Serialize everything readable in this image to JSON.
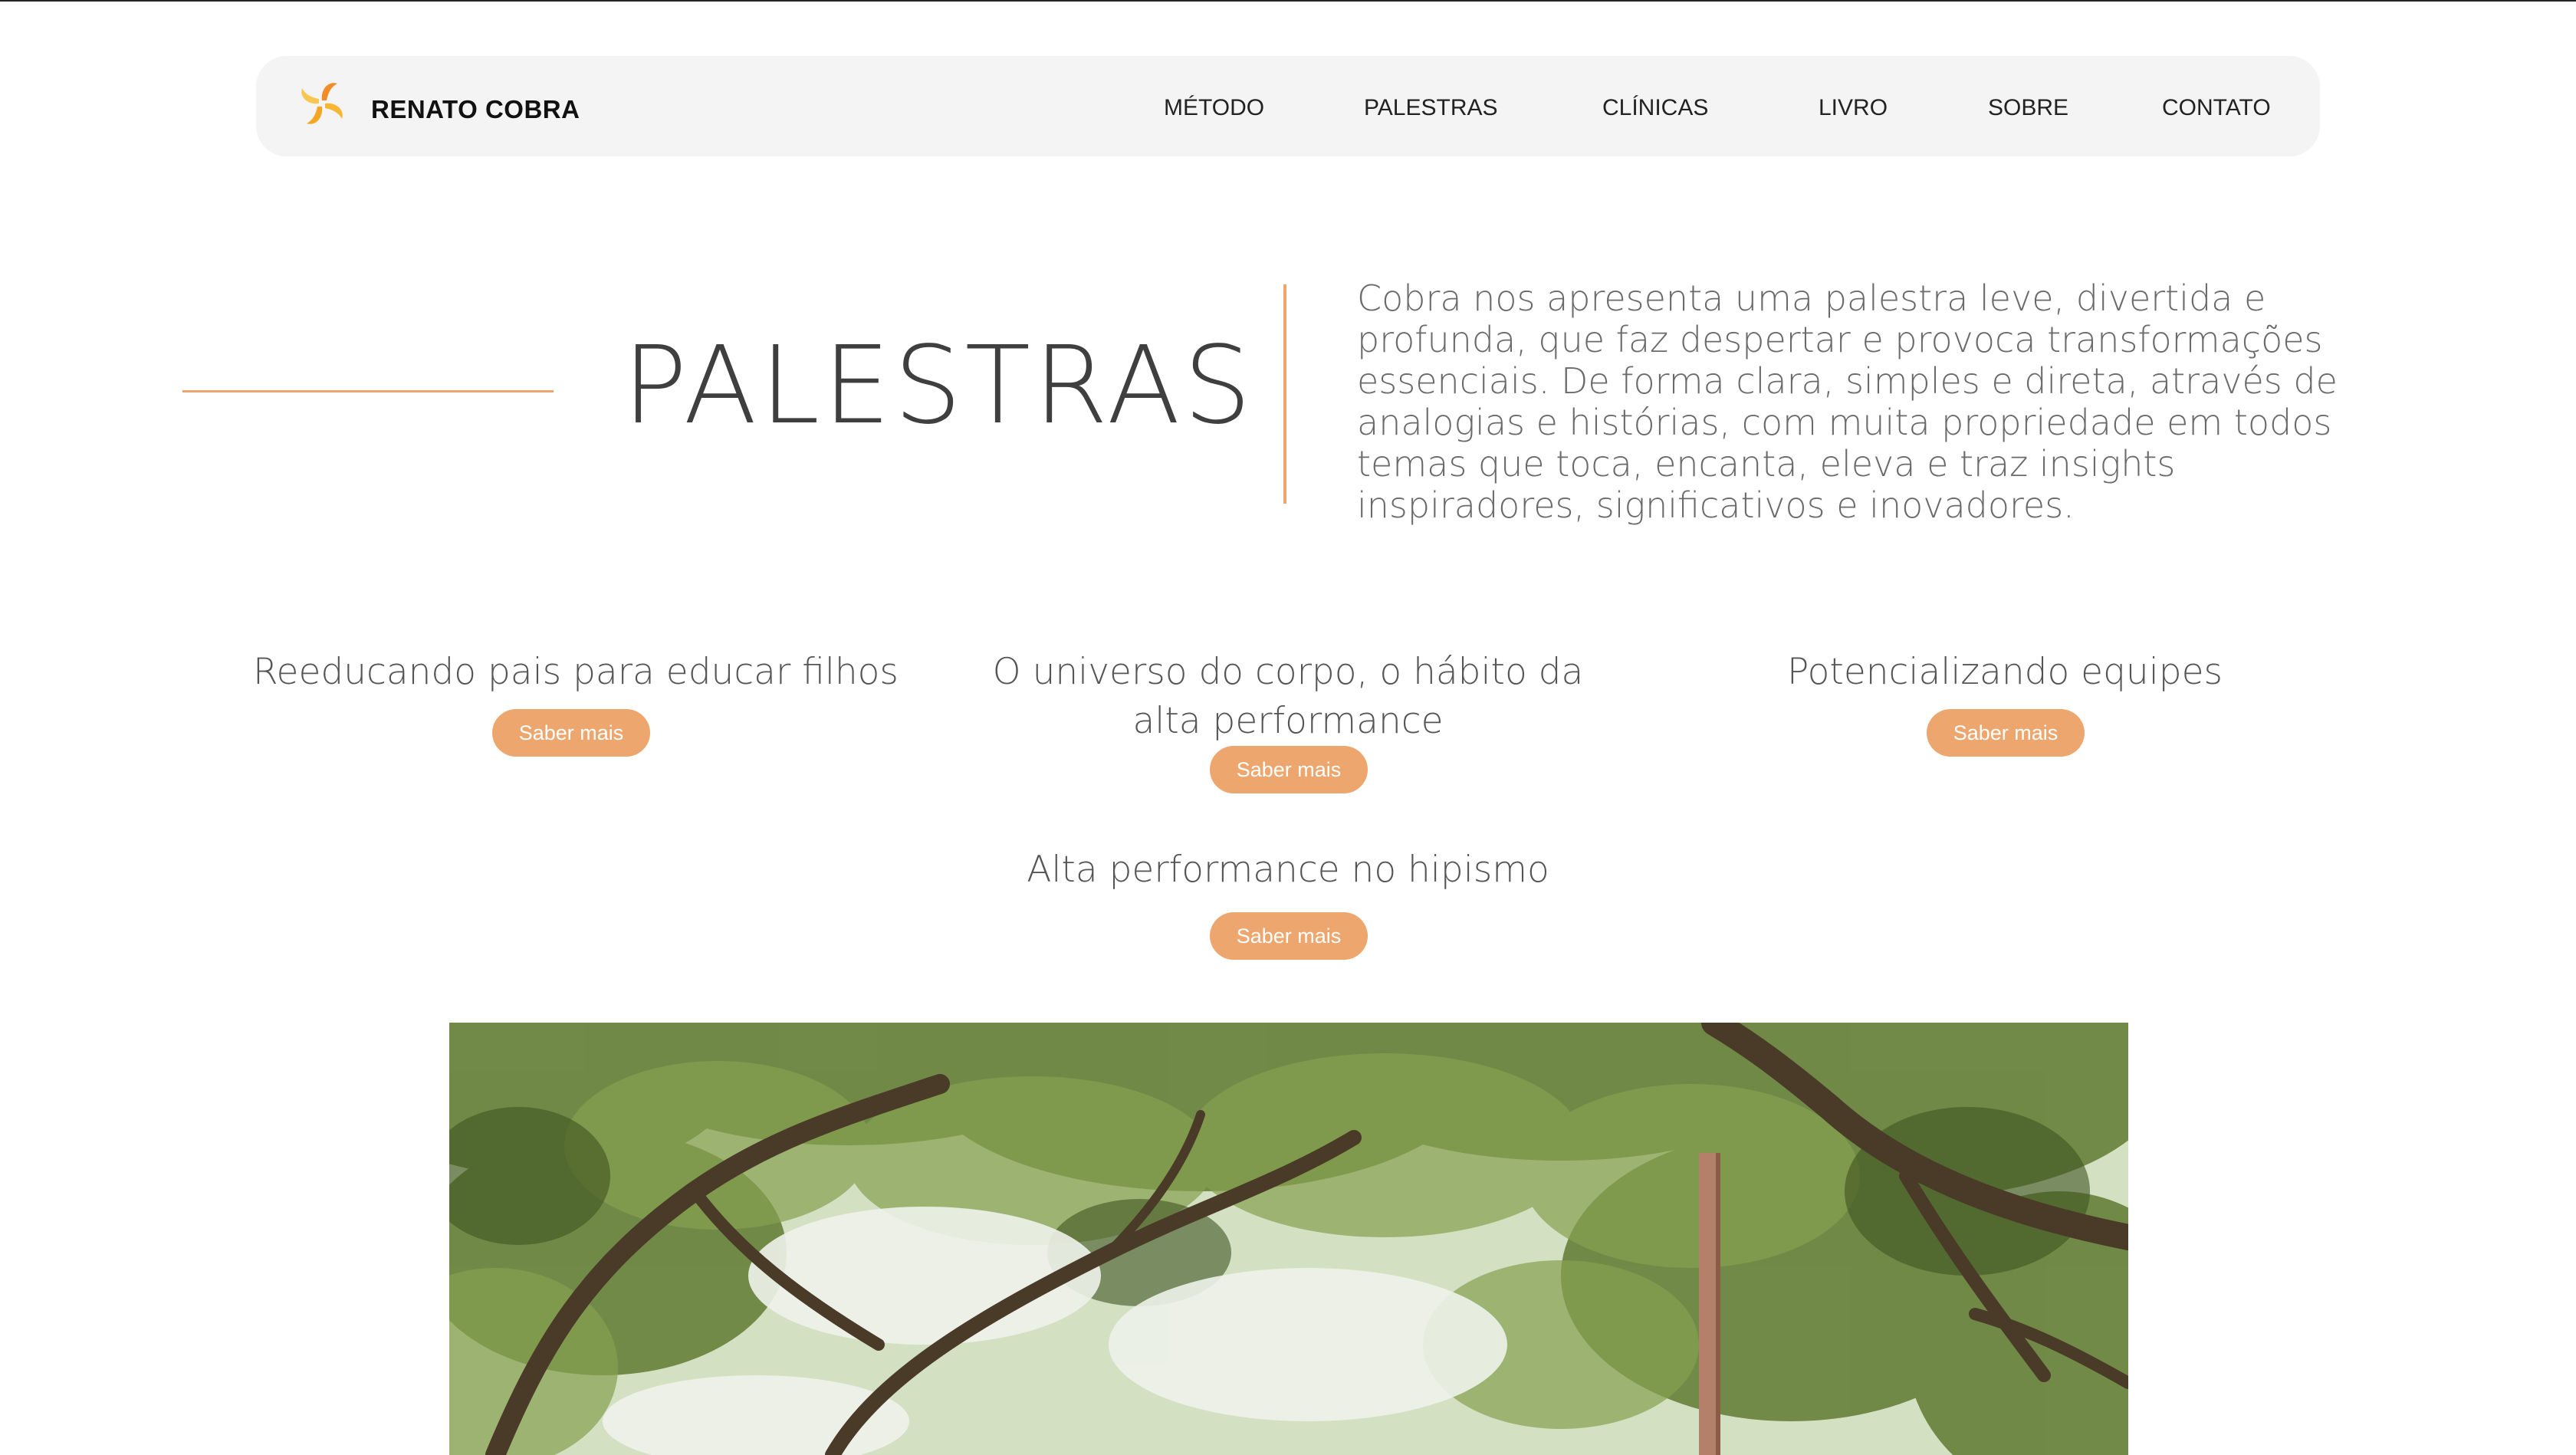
{
  "header": {
    "brand": "RENATO COBRA",
    "nav": [
      "MÉTODO",
      "PALESTRAS",
      "CLÍNICAS",
      "LIVRO",
      "SOBRE",
      "CONTATO"
    ]
  },
  "intro": {
    "title": "PALESTRAS",
    "description": "Cobra nos apresenta uma palestra leve, divertida e profunda, que faz despertar e provoca transformações essenciais. De forma clara, simples e direta, através de analogias e histórias, com muita propriedade em todos temas que toca, encanta, eleva e traz insights inspiradores, significativos e inovadores."
  },
  "talks": [
    {
      "title": "Reeducando pais para educar filhos",
      "button": "Saber mais"
    },
    {
      "title_line1": "O universo do corpo, o hábito da",
      "title_line2": "alta performance",
      "button": "Saber mais"
    },
    {
      "title": "Potencializando equipes",
      "button": "Saber mais"
    },
    {
      "title": "Alta performance no hipismo",
      "button": "Saber mais"
    }
  ],
  "colors": {
    "accent": "#eda76e",
    "nav_background": "#f4f4f4",
    "text": "#555555"
  },
  "icons": {
    "logo": "pinwheel-logo-icon"
  }
}
